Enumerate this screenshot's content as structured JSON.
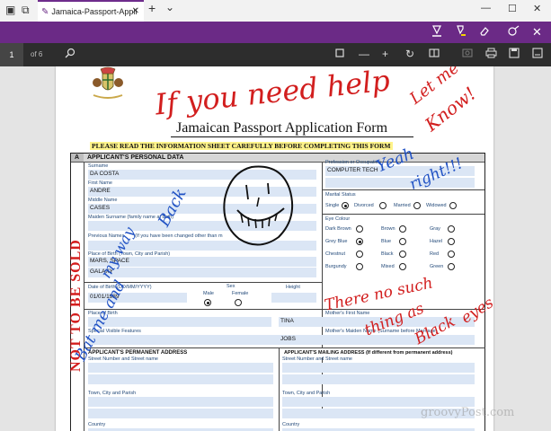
{
  "browser": {
    "tab_title": "Jamaica-Passport-Appli",
    "tab_close": "✕",
    "new_tab": "+",
    "tab_menu": "⌄",
    "minimize": "—",
    "maximize": "☐",
    "close": "✕"
  },
  "pdf_toolbar": {
    "page_number": "1",
    "page_total": "of 6"
  },
  "form": {
    "title": "Jamaican Passport Application Form",
    "banner": "PLEASE READ THE INFORMATION SHEET CAREFULLY BEFORE COMPLETING THIS FORM",
    "section_letter": "A",
    "section_a_title": "APPLICANT'S PERSONAL DATA",
    "surname_label": "Surname",
    "surname_value": "DA COSTA",
    "first_name_label": "First Name",
    "first_name_value": "ANDRE",
    "middle_name_label": "Middle Name",
    "middle_name_value": "CASES",
    "maiden_label": "Maiden Surname (family name at birth)",
    "previous_names_label": "Previous Names",
    "previous_names_note": "(If you have been changed other than m",
    "place_of_birth_label": "Place of Birth (Town, City and Parish)",
    "place_of_birth_value1": "MARS, SPACE",
    "place_of_birth_value2": "GALAXY",
    "dob_label": "Date of Birth (DD/MM/YYYY)",
    "dob_value": "01/01/1989",
    "sex_label": "Sex",
    "male_label": "Male",
    "female_label": "Female",
    "height_label": "Height",
    "profession_label": "Profession or Occupation",
    "profession_value": "COMPUTER TECH",
    "marital_label": "Marital Status",
    "marital_options": [
      "Single",
      "Divorced",
      "Married",
      "Widowed"
    ],
    "eye_label": "Eye Colour",
    "eye_options": [
      "Dark Brown",
      "Brown",
      "Gray",
      "Grey Blue",
      "Blue",
      "Hazel",
      "Chestnut",
      "Black",
      "Red",
      "Burgundy",
      "Mixed",
      "Green"
    ],
    "place_birth2_label": "Place of Birth",
    "mother_first_label": "Mother's First Name",
    "mother_first_value": "TINA",
    "special_features_label": "Special Visible Features",
    "mother_maiden_label": "Mother's Maiden Name (Surname before Marriage)",
    "mother_maiden_value": "JOBS",
    "perm_addr_title": "APPLICANT'S PERMANENT ADDRESS",
    "mail_addr_title": "APPLICANT'S MAILING ADDRESS (If different from permanent address)",
    "street_label": "Street Number and Street name",
    "town_label": "Town, City and Parish",
    "country_label": "Country"
  },
  "annotations": {
    "ink_red_1": "If you need help",
    "ink_red_2": "Let me",
    "ink_red_3": "Know!",
    "ink_blue_1": "Yeah",
    "ink_blue_2": "right!!!",
    "ink_red_4": "There no such",
    "ink_red_5": "thing as",
    "ink_red_6": "Black",
    "ink_red_7": "eyes",
    "ink_blue_3": "Bat me and",
    "ink_blue_4": "my way",
    "ink_blue_5": "Back",
    "stamp": "NOT TO BE SOLD"
  },
  "watermark": "groovyPost.com",
  "colors": {
    "accent": "#6b2a86",
    "ink_red": "#d21e1e",
    "ink_blue": "#2152c4"
  }
}
